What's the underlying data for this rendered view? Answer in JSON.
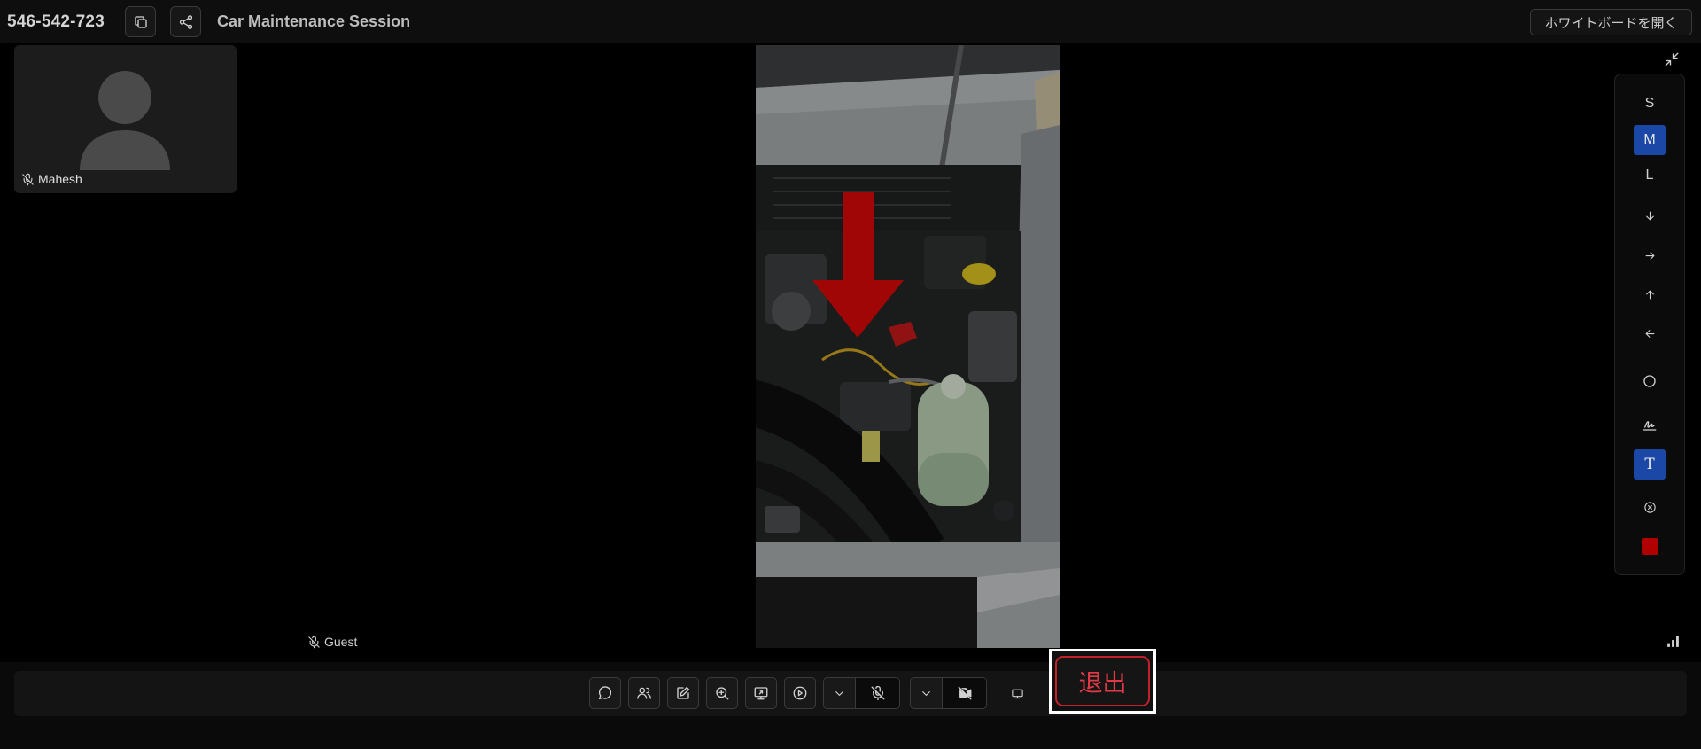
{
  "header": {
    "meeting_id": "546-542-723",
    "title": "Car Maintenance Session",
    "whiteboard_button": "ホワイトボードを開く",
    "copy_icon": "copy-icon",
    "share_icon": "share-icon"
  },
  "participants": [
    {
      "name": "Mahesh",
      "muted": true,
      "avatar": "default-avatar-icon"
    }
  ],
  "main_video": {
    "participant": "Guest",
    "muted": true,
    "annotation": "red-arrow-down"
  },
  "annotation_toolbar": {
    "sizes": [
      {
        "label": "S",
        "active": false
      },
      {
        "label": "M",
        "active": true
      },
      {
        "label": "L",
        "active": false
      }
    ],
    "tools": [
      "arrow-down-icon",
      "arrow-right-icon",
      "arrow-up-icon",
      "arrow-left-icon",
      "circle-icon",
      "signature-icon",
      "text-icon",
      "clear-icon"
    ],
    "text_tool_label": "T",
    "text_tool_active": true,
    "selected_color": "#b00000"
  },
  "controls": {
    "buttons": [
      "chat-icon",
      "participants-icon",
      "whiteboard-icon",
      "zoom-in-icon",
      "screen-share-icon",
      "record-icon",
      "chevron-down-icon",
      "mic-off-icon",
      "chevron-down-icon",
      "video-off-icon",
      "monitor-icon"
    ],
    "exit_label": "退出"
  },
  "colors": {
    "accent": "#1b48a6",
    "exit": "#e23a45",
    "annotation_red": "#b00000",
    "background": "#000000"
  }
}
